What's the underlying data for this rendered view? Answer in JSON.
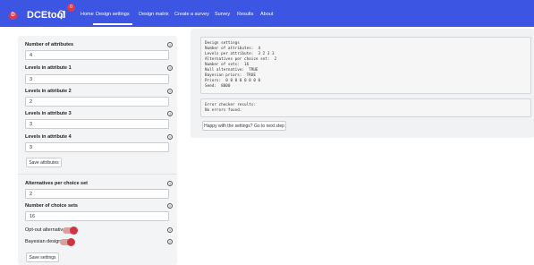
{
  "brand": {
    "name": "DCEtool",
    "logo_letter": "D",
    "notification_count": "0"
  },
  "nav": {
    "items": [
      {
        "label": "Home"
      },
      {
        "label": "Design settings"
      },
      {
        "label": "Design matrix"
      },
      {
        "label": "Create a survey"
      },
      {
        "label": "Survey"
      },
      {
        "label": "Results"
      },
      {
        "label": "About"
      }
    ],
    "active": "Design settings"
  },
  "form": {
    "num_attributes": {
      "label": "Number of attributes",
      "value": "4"
    },
    "levels": [
      {
        "label": "Levels in attribute 1",
        "value": "3"
      },
      {
        "label": "Levels in attribute 2",
        "value": "2"
      },
      {
        "label": "Levels in attribute 3",
        "value": "3"
      },
      {
        "label": "Levels in attribute 4",
        "value": "3"
      }
    ],
    "save_attributes_label": "Save attributes",
    "alternatives": {
      "label": "Alternatives per choice set",
      "value": "2"
    },
    "choice_sets": {
      "label": "Number of choice sets",
      "value": "16"
    },
    "opt_out": {
      "label": "Opt-out alternative",
      "on": true
    },
    "bayesian": {
      "label": "Bayesian design",
      "on": true
    },
    "save_settings_label": "Save settings",
    "help_symbol": "?"
  },
  "summary": {
    "lines": [
      "Design settings",
      "Number of attributes:  4",
      "Levels per attribute:  3 2 3 3",
      "Alternatives per choice set:  2",
      "Number of sets:  16",
      "Null alternative:  TRUE",
      "Bayesian priors:  TRUE",
      "Priors:  0 0 0 0 0 0 0 0",
      "Seed:  8000"
    ]
  },
  "errors": {
    "lines": [
      "Error checker results:",
      "No errors found."
    ]
  },
  "next_step_label": "Happy with the settings? Go to next step",
  "colors": {
    "navbar": "#3c55e2",
    "toggle_on": "#d0343f",
    "badge": "#e03a4a"
  }
}
